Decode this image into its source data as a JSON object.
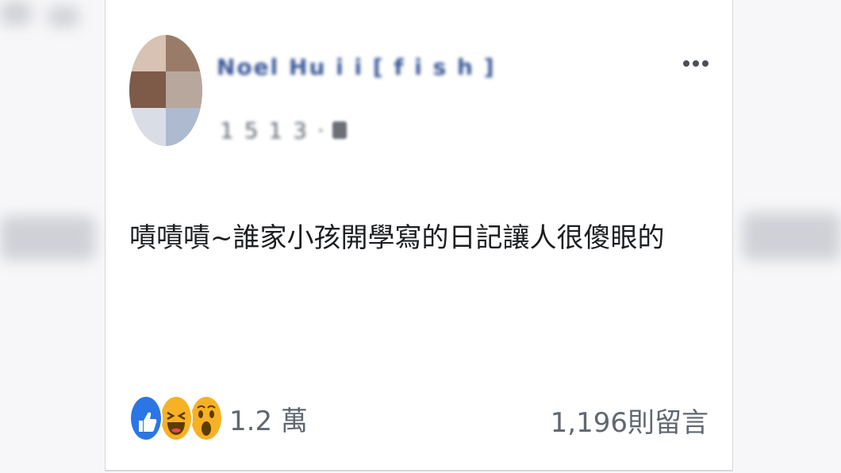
{
  "post": {
    "author_name": "Noel Hu i i  [ f i s h  ] ",
    "timestamp": "1 5 1 3  · ",
    "body_text": "嘖嘖嘖~誰家小孩開學寫的日記讓人很傻眼的",
    "reaction_count": "1.2 萬",
    "comment_count": "1,196則留言"
  },
  "reactions": [
    {
      "type": "like",
      "icon": "like-icon",
      "color": "#2b76e5"
    },
    {
      "type": "haha",
      "icon": "haha-icon",
      "color": "#f7b125"
    },
    {
      "type": "wow",
      "icon": "wow-icon",
      "color": "#f7b125"
    }
  ],
  "colors": {
    "author": "#3b5998",
    "meta": "#606770",
    "body": "#1c1e21"
  }
}
